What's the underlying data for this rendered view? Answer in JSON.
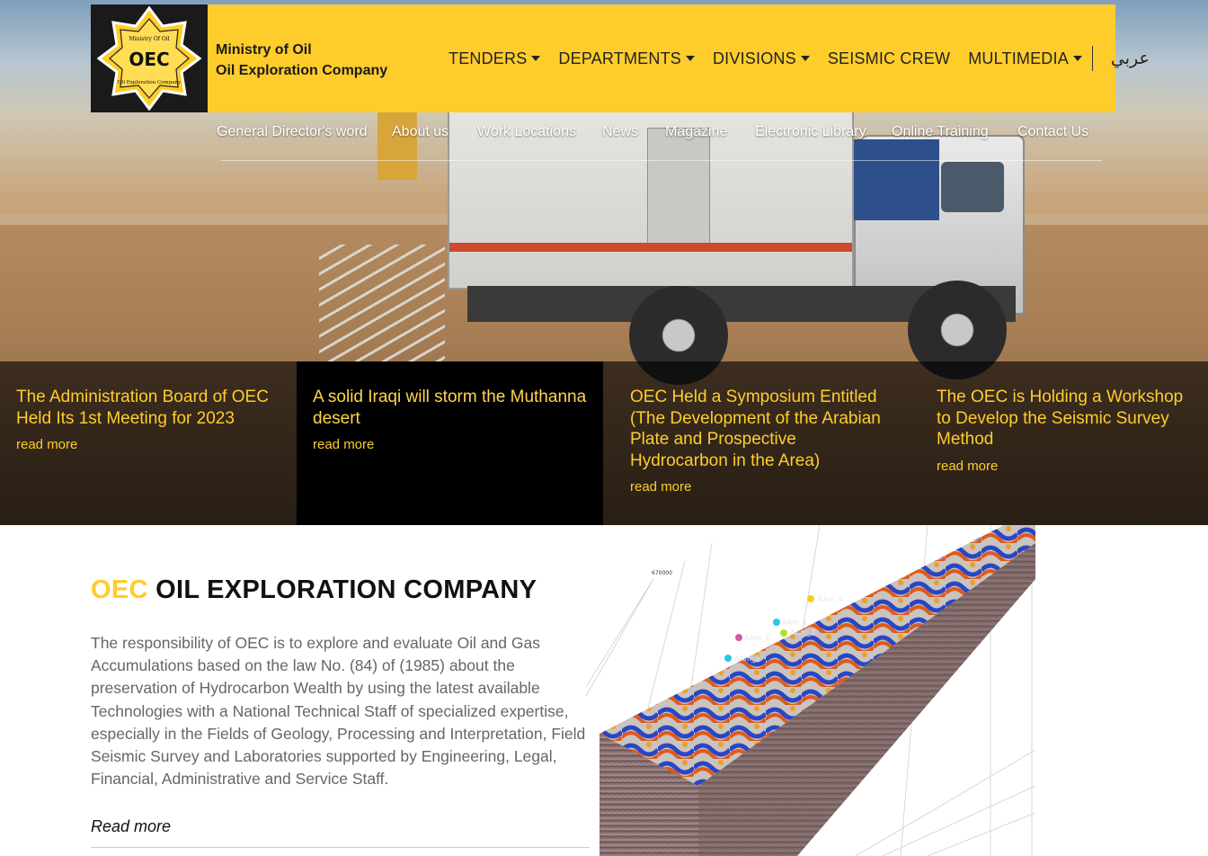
{
  "header": {
    "logo_alt": "OEC",
    "brand_line1": "Ministry of Oil",
    "brand_line2": "Oil Exploration Company",
    "nav": [
      {
        "label": "TENDERS",
        "dropdown": true
      },
      {
        "label": "DEPARTMENTS",
        "dropdown": true
      },
      {
        "label": "DIVISIONS",
        "dropdown": true
      },
      {
        "label": "SEISMIC CREW",
        "dropdown": false
      },
      {
        "label": "MULTIMEDIA",
        "dropdown": true
      }
    ],
    "language": "عربي"
  },
  "subnav": [
    "General Director's word",
    "About us",
    "Work Locations",
    "News",
    "Magazine",
    "Electronic Library",
    "Online Training",
    "Contact Us"
  ],
  "news": [
    {
      "title": "The Administration Board of OEC Held Its 1st Meeting for 2023",
      "link": "read more",
      "active": false
    },
    {
      "title": "A solid Iraqi will storm the Muthanna desert",
      "link": "read more",
      "active": true
    },
    {
      "title": "OEC Held a Symposium Entitled (The Development of the Arabian Plate and Prospective Hydrocarbon in the Area)",
      "link": "read more",
      "active": false
    },
    {
      "title": "The OEC is Holding a Workshop to Develop the Seismic Survey Method",
      "link": "read more",
      "active": false
    }
  ],
  "about": {
    "title_accent": "OEC",
    "title_rest": " OIL EXPLORATION COMPANY",
    "body": "The responsibility of OEC is to explore and evaluate Oil and Gas Accumulations based on the law No. (84) of (1985) about the preservation of Hydrocarbon Wealth by using the latest available Technologies with a National Technical Staff of specialized expertise, especially in the Fields of Geology, Processing and Interpretation, Field Seismic Survey and Laboratories supported by Engineering, Legal, Financial, Administrative and Service Staff.",
    "read_more": "Read more"
  },
  "seismic_labels": [
    "AAm_4",
    "AAm_1",
    "AAm_3",
    "AAm_2",
    "AAm_5"
  ],
  "seismic_axis": "670000",
  "colors": {
    "accent": "#ffcd2b",
    "header_bg": "#ffcd2b",
    "logo_bg": "#1a1a1a",
    "news_overlay": "rgba(0,0,0,0.62)"
  }
}
